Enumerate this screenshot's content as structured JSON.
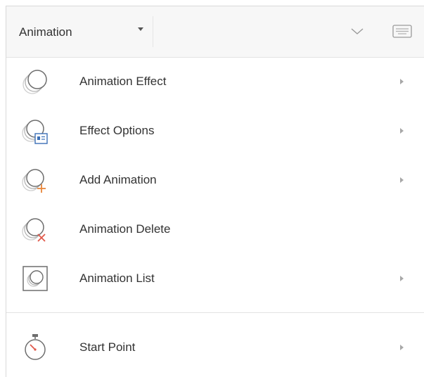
{
  "header": {
    "dropdown_label": "Animation",
    "icons": [
      "chevron-down-icon",
      "keyboard-icon"
    ]
  },
  "menu": {
    "items": [
      {
        "label": "Animation Effect",
        "icon": "animation-effect-icon",
        "has_submenu": true
      },
      {
        "label": "Effect Options",
        "icon": "effect-options-icon",
        "has_submenu": true
      },
      {
        "label": "Add Animation",
        "icon": "add-animation-icon",
        "has_submenu": true
      },
      {
        "label": "Animation Delete",
        "icon": "animation-delete-icon",
        "has_submenu": false
      },
      {
        "label": "Animation List",
        "icon": "animation-list-icon",
        "has_submenu": true
      }
    ],
    "start_point": {
      "label": "Start Point",
      "icon": "stopwatch-icon",
      "has_submenu": true
    }
  },
  "colors": {
    "header_bg": "#f7f7f7",
    "text": "#333333",
    "icon_gray": "#8a8a8a",
    "accent_blue": "#3b6fb6",
    "accent_orange": "#e8863a",
    "accent_red": "#e0584a",
    "divider": "#e3e3e3"
  }
}
